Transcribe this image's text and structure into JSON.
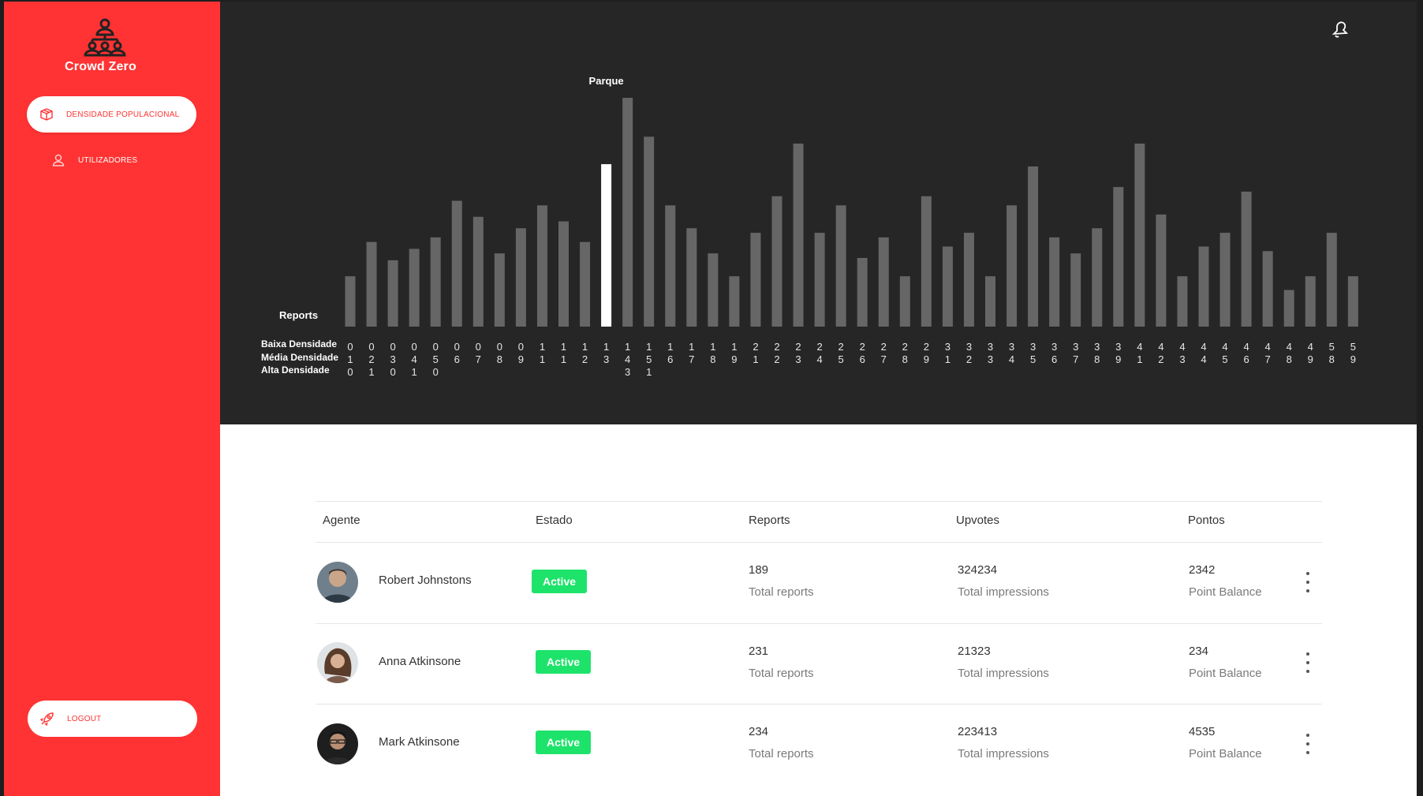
{
  "app": {
    "brand": "Crowd Zero"
  },
  "sidebar": {
    "items": [
      {
        "label": "DENSIDADE POPULACIONAL",
        "icon": "box-icon",
        "active": true
      },
      {
        "label": "UTILIZADORES",
        "icon": "user-icon",
        "active": false
      }
    ],
    "logout_label": "LOGOUT"
  },
  "colors": {
    "accent": "#ff3333",
    "panel": "#262626",
    "bar": "#666666",
    "bar_highlight": "#ffffff",
    "status": "#1ee36b"
  },
  "chart_data": {
    "type": "bar",
    "highlight_index": 12,
    "highlight_label": "Parque",
    "ylabel": "Reports",
    "legend": [
      "Baixa Densidade",
      "Média Densidade",
      "Alta Densidade"
    ],
    "categories": [
      "010",
      "021",
      "030",
      "041",
      "050",
      "06",
      "07",
      "08",
      "09",
      "11",
      "11",
      "12",
      "13",
      "143",
      "151",
      "16",
      "17",
      "18",
      "19",
      "21",
      "22",
      "23",
      "24",
      "25",
      "26",
      "27",
      "28",
      "29",
      "31",
      "32",
      "33",
      "34",
      "35",
      "36",
      "37",
      "38",
      "39",
      "41",
      "42",
      "43",
      "44",
      "45",
      "46",
      "47",
      "48",
      "49",
      "58",
      "59"
    ],
    "values": [
      22,
      37,
      29,
      34,
      39,
      55,
      48,
      32,
      43,
      53,
      46,
      37,
      71,
      100,
      83,
      53,
      43,
      32,
      22,
      41,
      57,
      80,
      41,
      53,
      30,
      39,
      22,
      57,
      35,
      41,
      22,
      53,
      70,
      39,
      32,
      43,
      61,
      80,
      49,
      22,
      35,
      41,
      59,
      33,
      16,
      22,
      41,
      22
    ]
  },
  "table": {
    "headers": {
      "agent": "Agente",
      "status": "Estado",
      "reports": "Reports",
      "upvotes": "Upvotes",
      "points": "Pontos"
    },
    "rows": [
      {
        "name": "Robert Johnstons",
        "status": "Active",
        "reports": "189",
        "reports_sub": "Total reports",
        "upvotes": "324234",
        "upvotes_sub": "Total impressions",
        "points": "2342",
        "points_sub": "Point Balance"
      },
      {
        "name": "Anna Atkinsone",
        "status": "Active",
        "reports": "231",
        "reports_sub": "Total reports",
        "upvotes": "21323",
        "upvotes_sub": "Total impressions",
        "points": "234",
        "points_sub": "Point Balance"
      },
      {
        "name": "Mark Atkinsone",
        "status": "Active",
        "reports": "234",
        "reports_sub": "Total reports",
        "upvotes": "223413",
        "upvotes_sub": "Total impressions",
        "points": "4535",
        "points_sub": "Point Balance"
      }
    ]
  }
}
